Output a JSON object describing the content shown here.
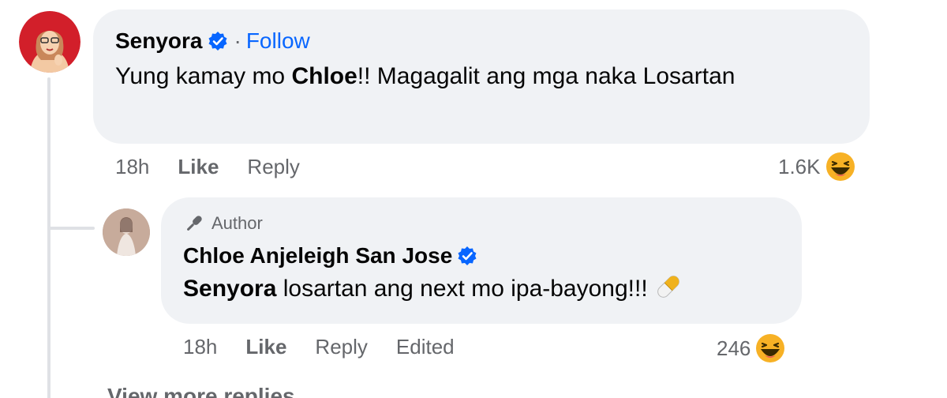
{
  "comment": {
    "author": "Senyora",
    "follow_sep": "·",
    "follow_label": "Follow",
    "text_before": "Yung kamay mo ",
    "text_bold": "Chloe",
    "text_after": "!! Magagalit ang mga naka Losartan",
    "time": "18h",
    "like_label": "Like",
    "reply_label": "Reply",
    "reaction_count": "1.6K",
    "reaction_icon": "haha-emoji-icon"
  },
  "reply": {
    "author_badge": "Author",
    "author": "Chloe Anjeleigh San Jose",
    "mention": "Senyora",
    "text": " losartan ang next mo ipa-bayong!!!",
    "emoji": "pill-emoji-icon",
    "time": "18h",
    "like_label": "Like",
    "reply_label": "Reply",
    "edited_label": "Edited",
    "reaction_count": "246",
    "reaction_icon": "haha-emoji-icon"
  },
  "view_more": "View more replies",
  "colors": {
    "bubble": "#f0f2f5",
    "link": "#0866ff",
    "verified": "#0866ff",
    "muted": "#65676b",
    "haha": "#f7b125"
  }
}
